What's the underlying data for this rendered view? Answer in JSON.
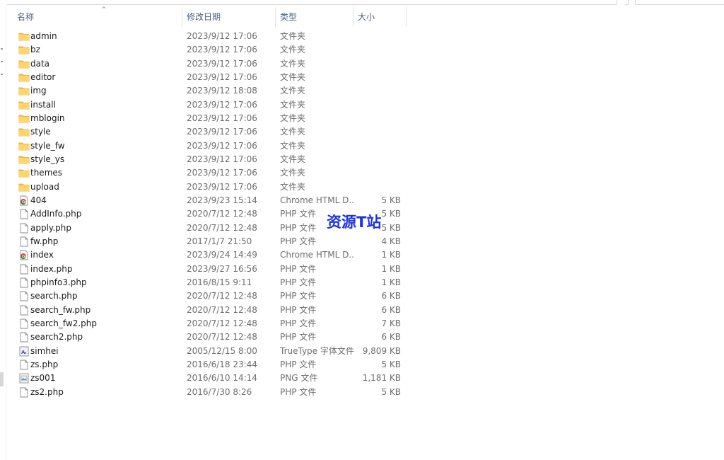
{
  "columns": {
    "name": "名称",
    "date": "修改日期",
    "type": "类型",
    "size": "大小"
  },
  "sort_indicator": "^",
  "files": [
    {
      "icon": "folder-icon",
      "name": "admin",
      "date": "2023/9/12 17:06",
      "type": "文件夹",
      "size": ""
    },
    {
      "icon": "folder-icon",
      "name": "bz",
      "date": "2023/9/12 17:06",
      "type": "文件夹",
      "size": ""
    },
    {
      "icon": "folder-icon",
      "name": "data",
      "date": "2023/9/12 17:06",
      "type": "文件夹",
      "size": ""
    },
    {
      "icon": "folder-icon",
      "name": "editor",
      "date": "2023/9/12 17:06",
      "type": "文件夹",
      "size": ""
    },
    {
      "icon": "folder-icon",
      "name": "img",
      "date": "2023/9/12 18:08",
      "type": "文件夹",
      "size": ""
    },
    {
      "icon": "folder-icon",
      "name": "install",
      "date": "2023/9/12 17:06",
      "type": "文件夹",
      "size": ""
    },
    {
      "icon": "folder-icon",
      "name": "mblogin",
      "date": "2023/9/12 17:06",
      "type": "文件夹",
      "size": ""
    },
    {
      "icon": "folder-icon",
      "name": "style",
      "date": "2023/9/12 17:06",
      "type": "文件夹",
      "size": ""
    },
    {
      "icon": "folder-icon",
      "name": "style_fw",
      "date": "2023/9/12 17:06",
      "type": "文件夹",
      "size": ""
    },
    {
      "icon": "folder-icon",
      "name": "style_ys",
      "date": "2023/9/12 17:06",
      "type": "文件夹",
      "size": ""
    },
    {
      "icon": "folder-icon",
      "name": "themes",
      "date": "2023/9/12 17:06",
      "type": "文件夹",
      "size": ""
    },
    {
      "icon": "folder-icon",
      "name": "upload",
      "date": "2023/9/12 17:06",
      "type": "文件夹",
      "size": ""
    },
    {
      "icon": "chrome-icon",
      "name": "404",
      "date": "2023/9/23 15:14",
      "type": "Chrome HTML D...",
      "size": "5 KB"
    },
    {
      "icon": "file-icon",
      "name": "AddInfo.php",
      "date": "2020/7/12 12:48",
      "type": "PHP 文件",
      "size": "5 KB"
    },
    {
      "icon": "file-icon",
      "name": "apply.php",
      "date": "2020/7/12 12:48",
      "type": "PHP 文件",
      "size": "5 KB"
    },
    {
      "icon": "file-icon",
      "name": "fw.php",
      "date": "2017/1/7 21:50",
      "type": "PHP 文件",
      "size": "4 KB"
    },
    {
      "icon": "chrome-icon",
      "name": "index",
      "date": "2023/9/24 14:49",
      "type": "Chrome HTML D...",
      "size": "1 KB"
    },
    {
      "icon": "file-icon",
      "name": "index.php",
      "date": "2023/9/27 16:56",
      "type": "PHP 文件",
      "size": "1 KB"
    },
    {
      "icon": "file-icon",
      "name": "phpinfo3.php",
      "date": "2016/8/15 9:11",
      "type": "PHP 文件",
      "size": "1 KB"
    },
    {
      "icon": "file-icon",
      "name": "search.php",
      "date": "2020/7/12 12:48",
      "type": "PHP 文件",
      "size": "6 KB"
    },
    {
      "icon": "file-icon",
      "name": "search_fw.php",
      "date": "2020/7/12 12:48",
      "type": "PHP 文件",
      "size": "6 KB"
    },
    {
      "icon": "file-icon",
      "name": "search_fw2.php",
      "date": "2020/7/12 12:48",
      "type": "PHP 文件",
      "size": "7 KB"
    },
    {
      "icon": "file-icon",
      "name": "search2.php",
      "date": "2020/7/12 12:48",
      "type": "PHP 文件",
      "size": "6 KB"
    },
    {
      "icon": "font-file-icon",
      "name": "simhei",
      "date": "2005/12/15 8:00",
      "type": "TrueType 字体文件",
      "size": "9,809 KB"
    },
    {
      "icon": "file-icon",
      "name": "zs.php",
      "date": "2016/6/18 23:44",
      "type": "PHP 文件",
      "size": "5 KB"
    },
    {
      "icon": "image-file-icon",
      "name": "zs001",
      "date": "2016/6/10 14:14",
      "type": "PNG 文件",
      "size": "1,181 KB"
    },
    {
      "icon": "file-icon",
      "name": "zs2.php",
      "date": "2016/7/30 8:26",
      "type": "PHP 文件",
      "size": "5 KB"
    }
  ],
  "watermark": "资源T站",
  "colors": {
    "folder": "#f4c34a",
    "header_text": "#4d6082",
    "watermark": "#1e33e0"
  }
}
